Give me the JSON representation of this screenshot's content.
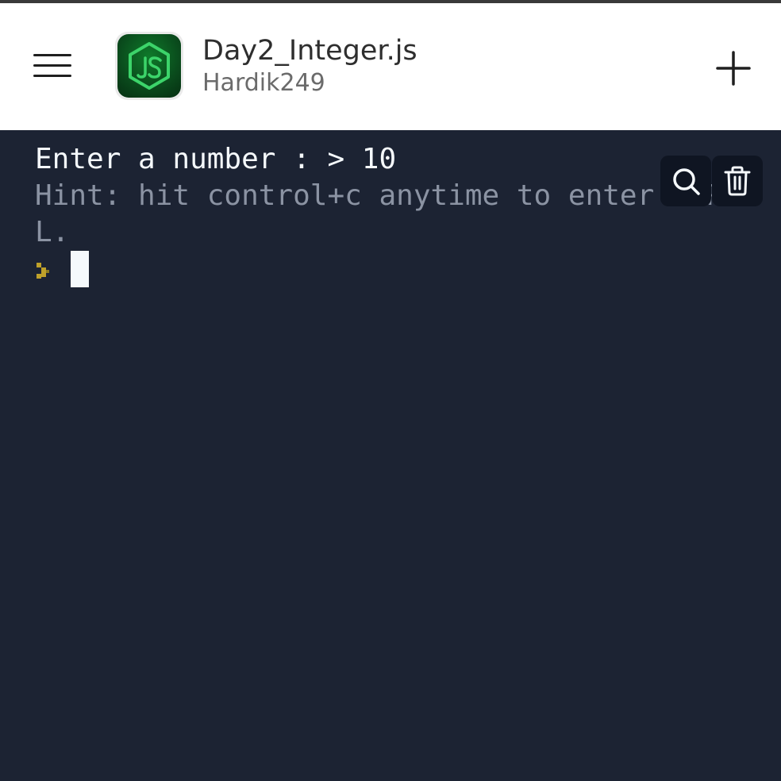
{
  "header": {
    "title": "Day2_Integer.js",
    "owner": "Hardik249",
    "app_icon": "nodejs-hexagon-icon",
    "menu_icon": "hamburger-menu-icon",
    "add_icon": "plus-icon"
  },
  "console": {
    "output_line": "Enter a number : > 10",
    "hint_line": "Hint: hit control+c anytime to enter REPL.",
    "prompt_icon": "chevron-prompt-icon",
    "search_icon": "magnifier-icon",
    "clear_icon": "trash-icon"
  },
  "colors": {
    "console_background": "#1c2333",
    "console_text": "#f5f9fc",
    "hint_text": "#8b93a3",
    "prompt_accent": "#bfa12a",
    "node_green": "#3cd46a"
  }
}
